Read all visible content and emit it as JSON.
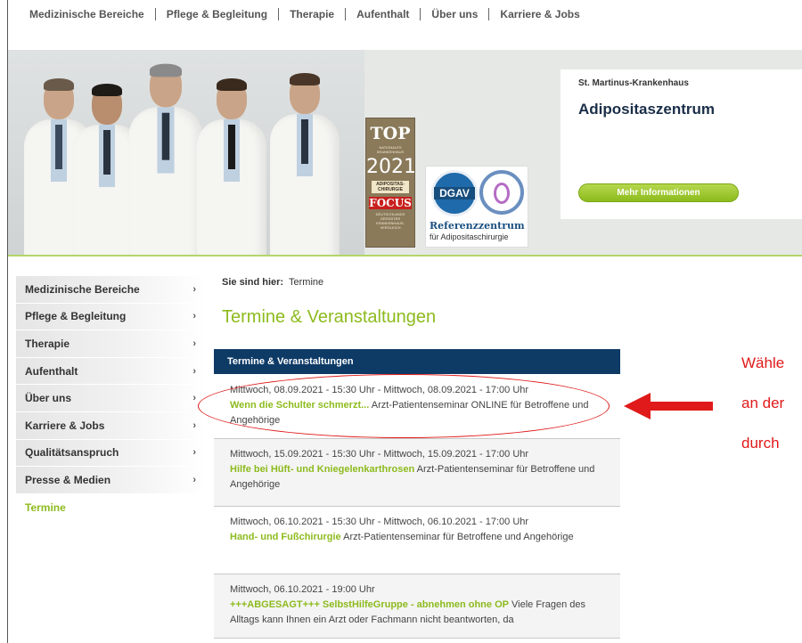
{
  "topnav": {
    "items": [
      "Medizinische Bereiche",
      "Pflege & Begleitung",
      "Therapie",
      "Aufenthalt",
      "Über uns",
      "Karriere & Jobs"
    ]
  },
  "hero": {
    "badge": {
      "top": "TOP",
      "subtitle": "NATIONALES KRANKENHAUS",
      "year": "2021",
      "category": "ADIPOSITAS-CHIRURGIE",
      "brand": "FOCUS",
      "note": "DEUTSCHLANDS GRÖSSTER KRANKENHAUS-VERGLEICH"
    },
    "dgav": {
      "logo": "DGAV",
      "line1": "Referenzzentrum",
      "line2": "für Adipositaschirurgie"
    },
    "info": {
      "org": "St. Martinus-Krankenhaus",
      "title": "Adipositaszentrum",
      "button": "Mehr Informationen"
    }
  },
  "sidebar": {
    "items": [
      {
        "label": "Medizinische Bereiche",
        "chev": "›"
      },
      {
        "label": "Pflege & Begleitung",
        "chev": "›"
      },
      {
        "label": "Therapie",
        "chev": "›"
      },
      {
        "label": "Aufenthalt",
        "chev": "›"
      },
      {
        "label": "Über uns",
        "chev": "›"
      },
      {
        "label": "Karriere & Jobs",
        "chev": "›"
      },
      {
        "label": "Qualitätsanspruch",
        "chev": "›"
      },
      {
        "label": "Presse & Medien",
        "chev": "›"
      },
      {
        "label": "Termine",
        "chev": ""
      }
    ]
  },
  "breadcrumb": {
    "label": "Sie sind hier:",
    "current": "Termine"
  },
  "page_title": "Termine & Veranstaltungen",
  "events": {
    "header": "Termine & Veranstaltungen",
    "items": [
      {
        "when": "Mittwoch, 08.09.2021 - 15:30 Uhr - Mittwoch, 08.09.2021 - 17:00 Uhr",
        "title": "Wenn die Schulter schmerzt...",
        "desc": " Arzt-Patientenseminar ONLINE für Betroffene und Angehörige"
      },
      {
        "when": "Mittwoch, 15.09.2021 - 15:30 Uhr - Mittwoch, 15.09.2021 - 17:00 Uhr",
        "title": "Hilfe bei Hüft- und Kniegelenkarthrosen",
        "desc": " Arzt-Patientenseminar für Betroffene und Angehörige"
      },
      {
        "when": "Mittwoch, 06.10.2021 - 15:30 Uhr - Mittwoch, 06.10.2021 - 17:00 Uhr",
        "title": "Hand- und Fußchirurgie",
        "desc": " Arzt-Patientenseminar für Betroffene und Angehörige"
      },
      {
        "when": "Mittwoch, 06.10.2021 - 19:00 Uhr",
        "title": "+++ABGESAGT+++ SelbstHilfeGruppe - abnehmen ohne OP",
        "desc": " Viele Fragen des Alltags kann Ihnen ein Arzt oder Fachmann nicht beantworten, da"
      }
    ]
  },
  "annotation": {
    "lines": [
      "Wähle",
      "an der",
      "durch"
    ],
    "color": "#e01a1a"
  },
  "colors": {
    "accent_green": "#8dbb1e",
    "navy": "#0e3a66"
  }
}
